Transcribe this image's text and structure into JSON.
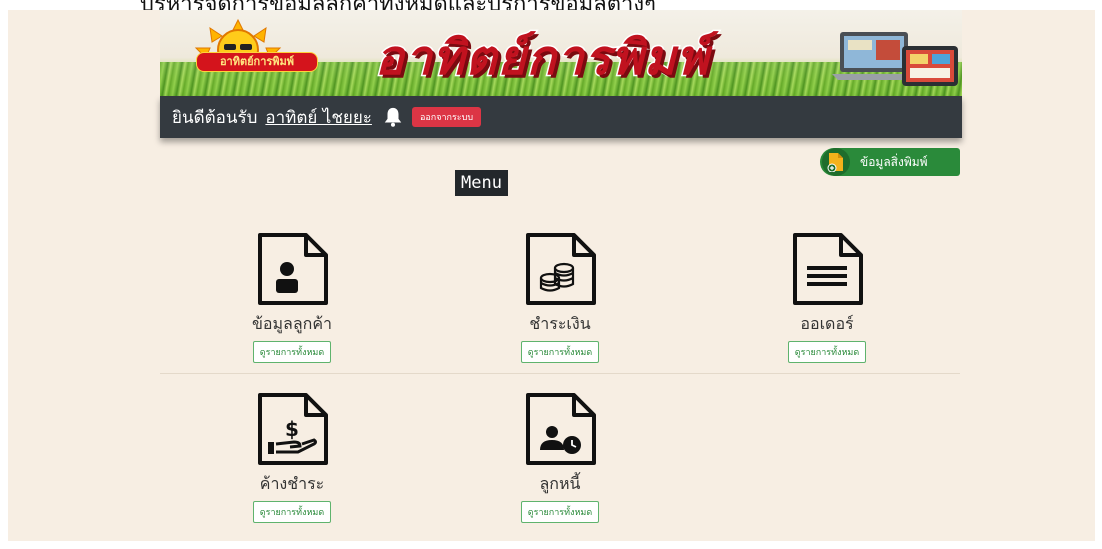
{
  "top_caption": "บริหารจัดการข้อมูลลูกค้าทั้งหมดและบริการข้อมูลต่างๆ",
  "banner": {
    "logo_text": "อาทิตย์การพิมพ์",
    "title": "อาทิตย์การพิมพ์"
  },
  "navbar": {
    "welcome": "ยินดีต้อนรับ",
    "user_name": "อาทิตย์ ไชยยะ",
    "logout_label": "ออกจากระบบ"
  },
  "print_info_button": "ข้อมูลสิ่งพิมพ์",
  "menu_title": "Menu",
  "cards": [
    {
      "label": "ข้อมูลลูกค้า",
      "link": "ดูรายการทั้งหมด",
      "icon": "customer-doc-icon"
    },
    {
      "label": "ชำระเงิน",
      "link": "ดูรายการทั้งหมด",
      "icon": "coins-doc-icon"
    },
    {
      "label": "ออเดอร์",
      "link": "ดูรายการทั้งหมด",
      "icon": "lines-doc-icon"
    },
    {
      "label": "ค้างชำระ",
      "link": "ดูรายการทั้งหมด",
      "icon": "dollar-hand-doc-icon"
    },
    {
      "label": "ลูกหนี้",
      "link": "ดูรายการทั้งหมด",
      "icon": "user-clock-doc-icon"
    }
  ],
  "colors": {
    "page_bg": "#f7eee3",
    "navbar_bg": "#343a40",
    "logout_bg": "#dc3545",
    "accent_green": "#2a8a3a"
  }
}
